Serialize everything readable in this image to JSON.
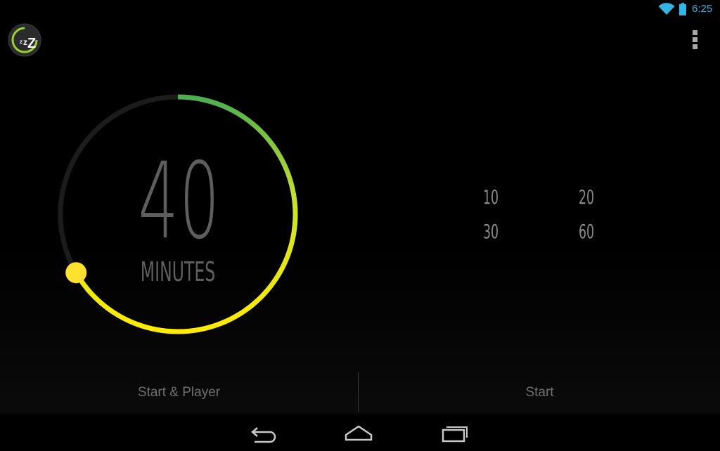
{
  "status_bar": {
    "time": "6:25",
    "icons": [
      "wifi-icon",
      "battery-icon"
    ],
    "accent_color": "#33b5e5"
  },
  "action_bar": {
    "app_icon": "sleep-timer-logo",
    "overflow_icon": "overflow-menu-icon"
  },
  "timer": {
    "value": "40",
    "unit": "MINUTES",
    "progress_fraction": 0.667,
    "arc_colors": {
      "start": "#4caf50",
      "end": "#ffec00",
      "track": "#1c1c1c",
      "knob": "#ffe12e"
    }
  },
  "presets": [
    "10",
    "20",
    "30",
    "60"
  ],
  "buttons": {
    "start_player": "Start & Player",
    "start": "Start"
  },
  "nav_bar": {
    "icons": [
      "back-icon",
      "home-icon",
      "recents-icon"
    ]
  }
}
